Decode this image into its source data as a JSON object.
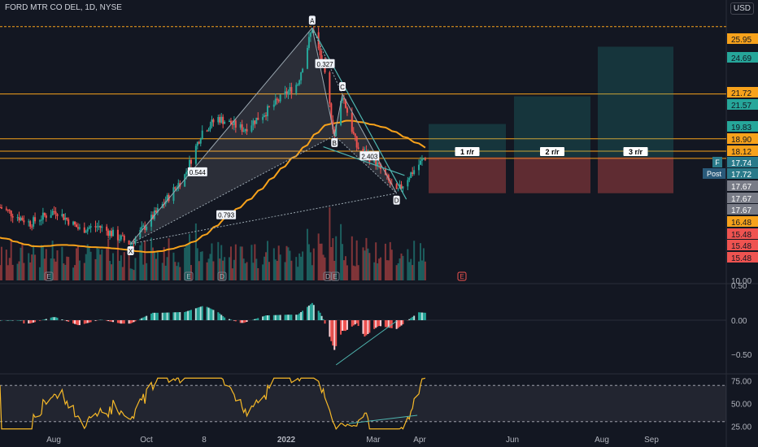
{
  "header": {
    "symbol": "FORD MTR CO DEL, 1D, NYSE",
    "currency": "USD"
  },
  "colors": {
    "bg": "#131722",
    "up": "#26a69a",
    "down": "#ef5350",
    "ma": "#f7a21b",
    "orange_line": "#f7a21b",
    "pattern": "#e8e8e8",
    "rsi": "#f7b928"
  },
  "chart_data": [
    {
      "type": "candlestick",
      "name": "price",
      "y_ticks": [
        10.0,
        24.0
      ],
      "x_ticks": [
        "Aug",
        "Oct",
        "8",
        "2022",
        "Mar",
        "Apr",
        "Jun",
        "Aug",
        "Sep"
      ],
      "horizontal_levels": [
        25.95,
        21.72,
        18.9,
        18.12,
        17.67
      ],
      "price_labels": [
        {
          "text": "25.95",
          "color": "#f7a21b"
        },
        {
          "text": "24.69",
          "color": "#26a69a"
        },
        {
          "text": "21.72",
          "color": "#f7a21b"
        },
        {
          "text": "21.57",
          "color": "#26a69a"
        },
        {
          "text": "19.83",
          "color": "#26a69a"
        },
        {
          "text": "18.90",
          "color": "#f7a21b"
        },
        {
          "text": "18.12",
          "color": "#f7a21b"
        },
        {
          "text": "17.74",
          "color": "#2a7a8a"
        },
        {
          "text": "17.72",
          "color": "#2a7a8a"
        },
        {
          "text": "17.67",
          "color": "#787b86"
        },
        {
          "text": "17.67",
          "color": "#787b86"
        },
        {
          "text": "17.67",
          "color": "#787b86"
        },
        {
          "text": "16.48",
          "color": "#f7a21b"
        },
        {
          "text": "15.48",
          "color": "#ef5350"
        },
        {
          "text": "15.48",
          "color": "#ef5350"
        },
        {
          "text": "15.48",
          "color": "#ef5350"
        }
      ],
      "tags": {
        "symbol": "F",
        "session": "Post"
      },
      "pattern_points": [
        {
          "label": "X",
          "date": "2021-09-21",
          "price": 12.3
        },
        {
          "label": "A",
          "date": "2022-01-13",
          "price": 25.87
        },
        {
          "label": "B",
          "date": "2022-01-27",
          "price": 19.1
        },
        {
          "label": "C",
          "date": "2022-02-01",
          "price": 21.7
        },
        {
          "label": "D",
          "date": "2022-03-07",
          "price": 15.48
        }
      ],
      "ratios": [
        "0.327",
        "2.403",
        "0.544",
        "0.793"
      ],
      "earnings_markers": [
        "E",
        "E",
        "D",
        "D",
        "E",
        "E"
      ],
      "risk_reward": [
        "1 r/r",
        "2 r/r",
        "3 r/r"
      ],
      "ma_label": "MA"
    },
    {
      "type": "histogram",
      "name": "momentum",
      "y_ticks": [
        "0.50",
        "0.00",
        "−0.50"
      ]
    },
    {
      "type": "line",
      "name": "rsi",
      "y_ticks": [
        "75.00",
        "50.00",
        "25.00"
      ],
      "band": [
        30,
        70
      ]
    }
  ]
}
